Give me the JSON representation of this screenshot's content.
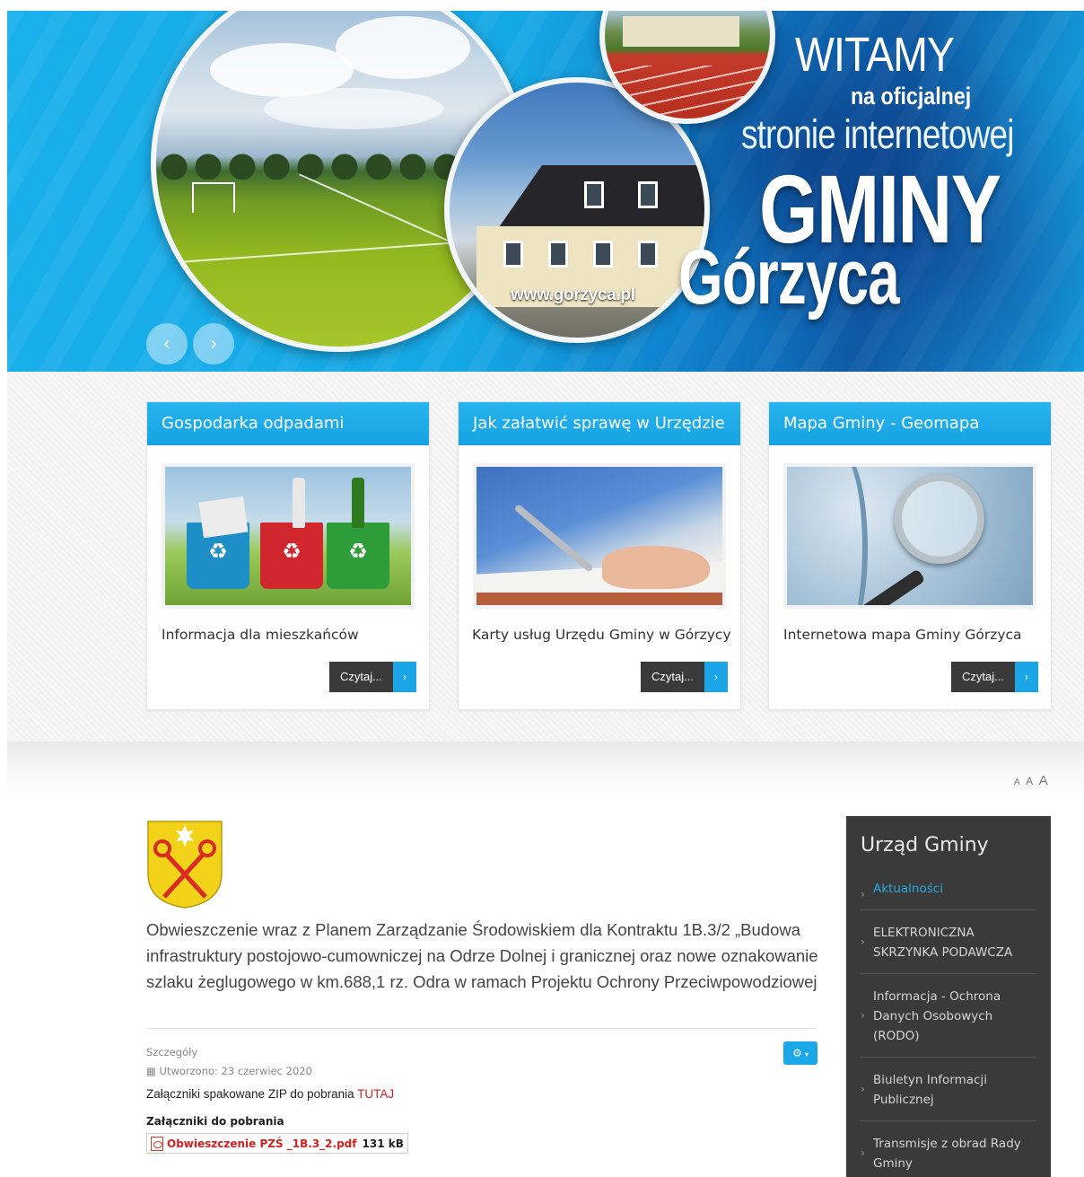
{
  "hero": {
    "line1": "WITAMY",
    "line2": "na oficjalnej",
    "line3": "stronie internetowej",
    "line4": "GMINY",
    "line5": "Górzyca",
    "url": "www.gorzyca.pl",
    "prev_label": "‹",
    "next_label": "›"
  },
  "cards": [
    {
      "title": "Gospodarka odpadami",
      "text": "Informacja dla mieszkańców",
      "button": "Czytaj..."
    },
    {
      "title": "Jak załatwić sprawę w Urzędzie",
      "text": "Karty usług Urzędu Gminy w Górzycy",
      "button": "Czytaj..."
    },
    {
      "title": "Mapa Gminy - Geomapa",
      "text": "Internetowa mapa Gminy Górzyca",
      "button": "Czytaj..."
    }
  ],
  "font_size_controls": [
    "A",
    "A",
    "A"
  ],
  "article": {
    "title": "Obwieszczenie wraz z Planem Zarządzanie Środowiskiem dla Kontraktu 1B.3/2 „Budowa infrastruktury postojowo-cumowniczej na Odrze Dolnej i granicznej oraz nowe oznakowanie szlaku żeglugowego w km.688,1 rz. Odra w ramach Projektu Ochrony Przeciwpowodziowej",
    "details_label": "Szczegóły",
    "created": "Utworzono: 23 czerwiec 2020",
    "zip_text": "Załączniki spakowane ZIP do pobrania ",
    "zip_link": "TUTAJ",
    "attachments_heading": "Załączniki do pobrania",
    "attachment_name": "Obwieszczenie PZŚ _1B.3_2.pdf",
    "attachment_size": "131 kB"
  },
  "sidebar": {
    "title": "Urząd Gminy",
    "items": [
      {
        "label": "Aktualności",
        "active": true
      },
      {
        "label": "ELEKTRONICZNA SKRZYNKA PODAWCZA",
        "active": false
      },
      {
        "label": "Informacja - Ochrona Danych Osobowych (RODO)",
        "active": false
      },
      {
        "label": "Biuletyn Informacji Publicznej",
        "active": false
      },
      {
        "label": "Transmisje z obrad Rady Gminy",
        "active": false
      }
    ]
  },
  "colors": {
    "accent": "#1aa6e6",
    "sidebar_bg": "#3a3a3a",
    "link_red": "#d91e1e",
    "button_dark": "#3a3a3a"
  }
}
